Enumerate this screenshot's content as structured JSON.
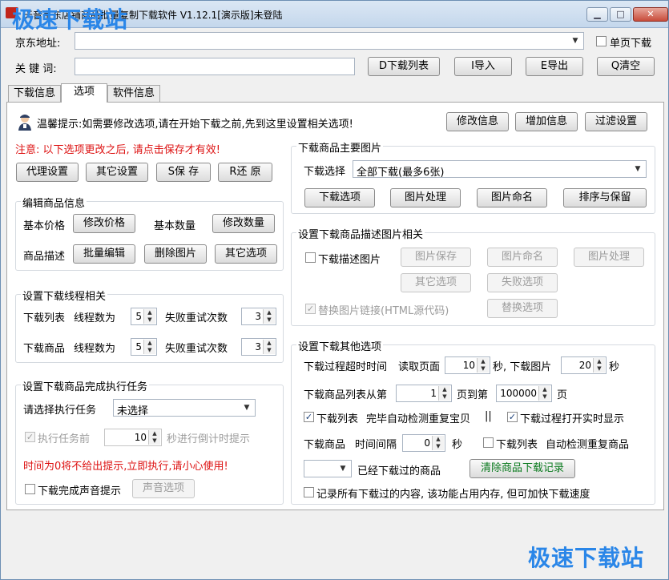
{
  "window": {
    "title": "天音京东店铺商品批量复制下载软件 V1.12.1[演示版]未登陆",
    "watermark_top": "极速下载站",
    "watermark_bottom": "极速下载站",
    "btn_min": "▁",
    "btn_max": "□",
    "btn_close": "✕"
  },
  "top": {
    "url_label": "京东地址:",
    "url_value": "",
    "single_page_label": "单页下载",
    "keyword_label": "关 键 词:",
    "keyword_value": "",
    "download_list_btn": "D下载列表",
    "import_btn": "I导入",
    "export_btn": "E导出",
    "clear_btn": "Q清空"
  },
  "tabs": [
    "下载信息",
    "选项",
    "软件信息"
  ],
  "tip": {
    "text": "温馨提示:如需要修改选项,请在开始下载之前,先到这里设置相关选项!",
    "modify_info_btn": "修改信息",
    "add_info_btn": "增加信息",
    "filter_btn": "过滤设置"
  },
  "notice": "注意: 以下选项更改之后, 请点击保存才有效!",
  "actions": {
    "proxy": "代理设置",
    "other": "其它设置",
    "save": "S保 存",
    "restore": "R还 原"
  },
  "edit_group": {
    "title": "编辑商品信息",
    "base_price_label": "基本价格",
    "modify_price_btn": "修改价格",
    "base_qty_label": "基本数量",
    "modify_qty_btn": "修改数量",
    "desc_label": "商品描述",
    "batch_edit_btn": "批量编辑",
    "delete_img_btn": "删除图片",
    "other_options_btn": "其它选项"
  },
  "thread_group": {
    "title": "设置下载线程相关",
    "list_label": "下载列表",
    "thread_label": "线程数为",
    "retry_label": "失败重试次数",
    "item_label": "下载商品",
    "list_threads": "5",
    "list_retries": "3",
    "item_threads": "5",
    "item_retries": "3"
  },
  "task_group": {
    "title": "设置下载商品完成执行任务",
    "select_label": "请选择执行任务",
    "select_value": "未选择",
    "before_label": "执行任务前",
    "before_value": "10",
    "countdown_label": "秒进行倒计时提示",
    "warning": "时间为0将不给出提示,立即执行,请小心使用!",
    "sound_label": "下载完成声音提示",
    "sound_btn": "声音选项"
  },
  "main_img_group": {
    "title": "下载商品主要图片",
    "select_label": "下载选择",
    "select_value": "全部下载(最多6张)",
    "download_options_btn": "下载选项",
    "image_process_btn": "图片处理",
    "image_name_btn": "图片命名",
    "sort_keep_btn": "排序与保留"
  },
  "desc_img_group": {
    "title": "设置下载商品描述图片相关",
    "download_desc_label": "下载描述图片",
    "img_save_btn": "图片保存",
    "img_name_btn": "图片命名",
    "img_process_btn": "图片处理",
    "other_options_btn": "其它选项",
    "fail_options_btn": "失败选项",
    "replace_link_label": "替换图片链接(HTML源代码)",
    "replace_options_btn": "替换选项"
  },
  "other_group": {
    "title": "设置下载其他选项",
    "timeout_label": "下载过程超时时间",
    "read_page_label": "读取页面",
    "read_page_value": "10",
    "sec_comma_label": "秒, 下载图片",
    "download_img_value": "20",
    "sec_label": "秒",
    "list_from_label": "下载商品列表从第",
    "page_from_value": "1",
    "page_to_label": "页到第",
    "page_to_value": "100000",
    "page_label": "页",
    "list_check_label": "下载列表",
    "auto_check_label": "完毕自动检测重复宝贝",
    "sep": "||",
    "realtime_label": "下载过程打开实时显示",
    "item_interval_label": "下载商品",
    "time_interval_label": "时间间隔",
    "interval_value": "0",
    "interval_sec": "秒",
    "list_auto_label": "下载列表",
    "auto_repeat_label": "自动检测重复商品",
    "downloaded_select_value": "",
    "downloaded_label": "已经下载过的商品",
    "clear_records_btn": "清除商品下载记录",
    "record_all_label": "记录所有下载过的内容, 该功能占用内存, 但可加快下载速度"
  },
  "colors": {
    "red_text": "#dd1111",
    "watermark": "#2a86e8",
    "green_btn_text": "#0a7a1e"
  }
}
